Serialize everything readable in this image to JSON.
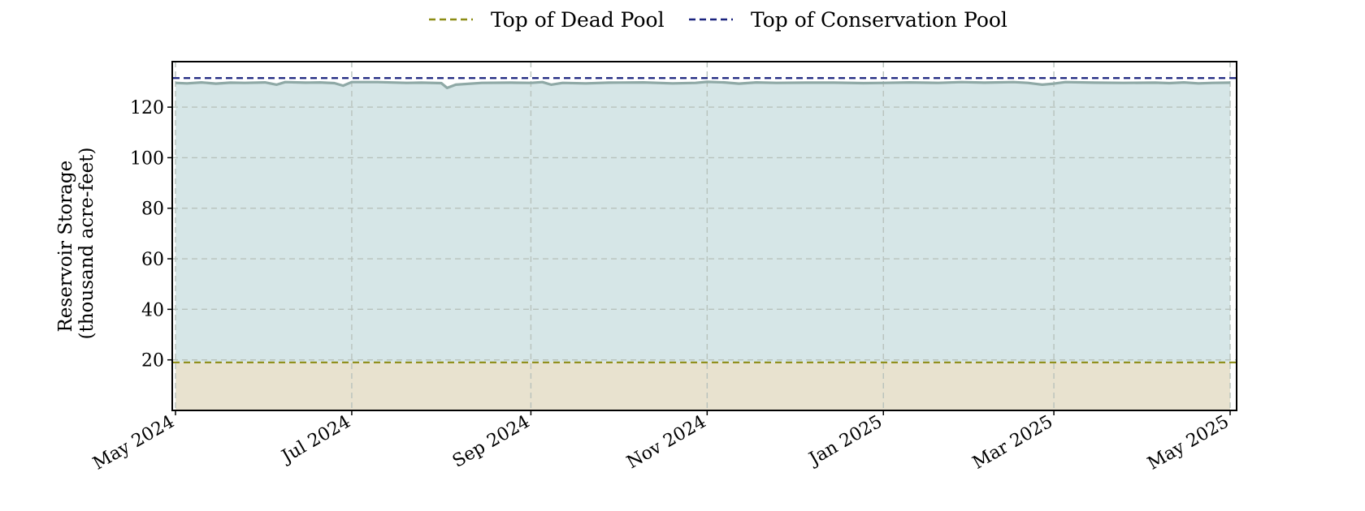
{
  "chart_data": {
    "type": "area",
    "title": "",
    "xlabel": "",
    "ylabel": "Reservoir Storage (thousand acre-feet)",
    "ylabel_lines": [
      "Reservoir Storage",
      "(thousand acre-feet)"
    ],
    "x_range": [
      "2024-05-01",
      "2025-05-01"
    ],
    "ylim": [
      0,
      138
    ],
    "yticks": [
      20,
      40,
      60,
      80,
      100,
      120
    ],
    "xticks": [
      {
        "date": "2024-05-01",
        "label": "May 2024"
      },
      {
        "date": "2024-07-01",
        "label": "Jul 2024"
      },
      {
        "date": "2024-09-01",
        "label": "Sep 2024"
      },
      {
        "date": "2024-11-01",
        "label": "Nov 2024"
      },
      {
        "date": "2025-01-01",
        "label": "Jan 2025"
      },
      {
        "date": "2025-03-01",
        "label": "Mar 2025"
      },
      {
        "date": "2025-05-01",
        "label": "May 2025"
      }
    ],
    "grid": true,
    "legend_position": "top-center",
    "reference_lines": [
      {
        "name": "Top of Dead Pool",
        "value": 19,
        "color": "#8c8c14",
        "style": "dashed"
      },
      {
        "name": "Top of Conservation Pool",
        "value": 131.5,
        "color": "#1a237e",
        "style": "dashed"
      }
    ],
    "series": [
      {
        "color": "#8fa9a6",
        "points": [
          [
            "2024-05-01",
            129.6
          ],
          [
            "2024-05-05",
            129.4
          ],
          [
            "2024-05-10",
            129.8
          ],
          [
            "2024-05-15",
            129.3
          ],
          [
            "2024-05-20",
            129.7
          ],
          [
            "2024-05-25",
            129.6
          ],
          [
            "2024-06-01",
            129.8
          ],
          [
            "2024-06-05",
            128.9
          ],
          [
            "2024-06-08",
            129.9
          ],
          [
            "2024-06-15",
            129.7
          ],
          [
            "2024-06-20",
            129.8
          ],
          [
            "2024-06-25",
            129.5
          ],
          [
            "2024-06-28",
            128.5
          ],
          [
            "2024-07-01",
            129.9
          ],
          [
            "2024-07-10",
            129.9
          ],
          [
            "2024-07-20",
            129.6
          ],
          [
            "2024-07-25",
            129.7
          ],
          [
            "2024-08-01",
            129.5
          ],
          [
            "2024-08-03",
            127.6
          ],
          [
            "2024-08-06",
            128.9
          ],
          [
            "2024-08-15",
            129.6
          ],
          [
            "2024-08-25",
            129.7
          ],
          [
            "2024-09-01",
            129.6
          ],
          [
            "2024-09-05",
            129.9
          ],
          [
            "2024-09-08",
            128.9
          ],
          [
            "2024-09-12",
            129.6
          ],
          [
            "2024-09-20",
            129.4
          ],
          [
            "2024-09-28",
            129.7
          ],
          [
            "2024-10-10",
            129.8
          ],
          [
            "2024-10-20",
            129.4
          ],
          [
            "2024-10-28",
            129.6
          ],
          [
            "2024-11-01",
            130.0
          ],
          [
            "2024-11-07",
            129.8
          ],
          [
            "2024-11-12",
            129.3
          ],
          [
            "2024-11-18",
            129.8
          ],
          [
            "2024-11-25",
            129.6
          ],
          [
            "2024-12-05",
            129.7
          ],
          [
            "2024-12-15",
            129.7
          ],
          [
            "2024-12-25",
            129.5
          ],
          [
            "2025-01-01",
            129.6
          ],
          [
            "2025-01-10",
            129.8
          ],
          [
            "2025-01-20",
            129.6
          ],
          [
            "2025-01-28",
            129.9
          ],
          [
            "2025-02-05",
            129.7
          ],
          [
            "2025-02-15",
            129.9
          ],
          [
            "2025-02-20",
            129.6
          ],
          [
            "2025-02-25",
            128.9
          ],
          [
            "2025-03-01",
            129.3
          ],
          [
            "2025-03-05",
            129.9
          ],
          [
            "2025-03-15",
            129.7
          ],
          [
            "2025-03-25",
            129.6
          ],
          [
            "2025-04-05",
            129.7
          ],
          [
            "2025-04-10",
            129.5
          ],
          [
            "2025-04-15",
            129.8
          ],
          [
            "2025-04-20",
            129.4
          ],
          [
            "2025-04-25",
            129.6
          ],
          [
            "2025-05-01",
            129.7
          ]
        ]
      }
    ]
  }
}
